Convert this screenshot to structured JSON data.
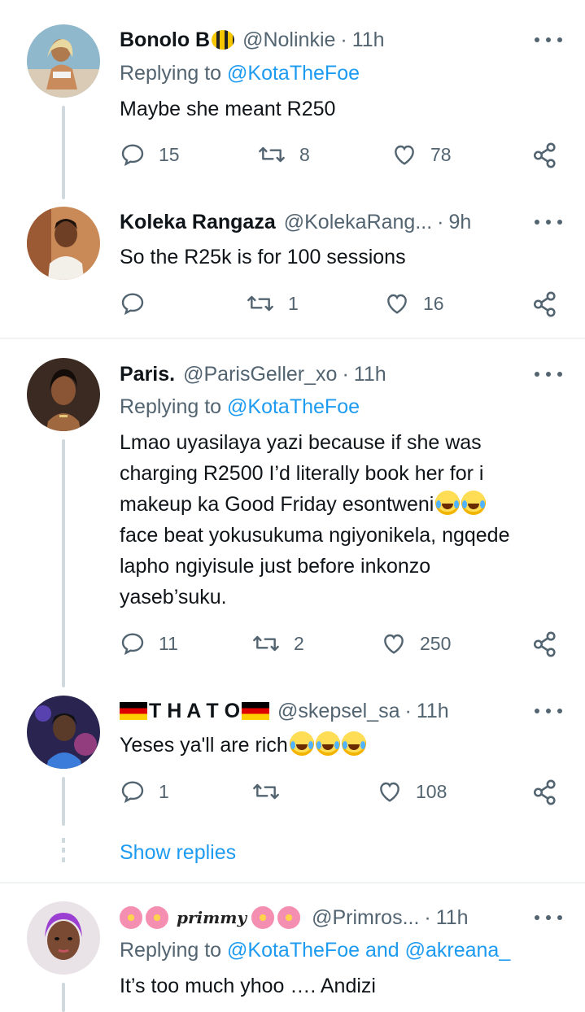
{
  "tweets": [
    {
      "name": "Bonolo B",
      "handle": "@Nolinkie",
      "time": "11h",
      "replying_prefix": "Replying to",
      "replying_to": "@KotaTheFoe",
      "text": "Maybe she meant R250",
      "replies": "15",
      "retweets": "8",
      "likes": "78"
    },
    {
      "name": "Koleka Rangaza",
      "handle": "@KolekaRang...",
      "time": "9h",
      "text": "So the R25k is for 100 sessions",
      "replies": "",
      "retweets": "1",
      "likes": "16"
    },
    {
      "name": "Paris.",
      "handle": "@ParisGeller_xo",
      "time": "11h",
      "replying_prefix": "Replying to",
      "replying_to": "@KotaTheFoe",
      "text_lines": [
        "Lmao uyasilaya yazi because if she was",
        "charging R2500 I’d literally book her for i",
        "makeup ka Good Friday esontweni",
        "face beat yokusukuma ngiyonikela, ngqede",
        "lapho ngiyisule just before inkonzo",
        "yaseb’suku."
      ],
      "replies": "11",
      "retweets": "2",
      "likes": "250"
    },
    {
      "name": "T H A T O",
      "handle": "@skepsel_sa",
      "time": "11h",
      "text": "Yeses ya'll are rich",
      "replies": "1",
      "retweets": "",
      "likes": "108"
    },
    {
      "name": "primmy",
      "handle": "@Primros...",
      "time": "11h",
      "replying_prefix": "Replying to",
      "replying_to": "@KotaTheFoe and @akreana_",
      "text": "It’s too much yhoo …. Andizi"
    }
  ],
  "show_replies": "Show replies",
  "colors": {
    "accent": "#1d9bf0",
    "muted": "#536471",
    "text": "#0f1419",
    "line": "#cfd9de"
  },
  "icons": [
    "reply-icon",
    "retweet-icon",
    "like-icon",
    "share-icon",
    "more-icon"
  ]
}
